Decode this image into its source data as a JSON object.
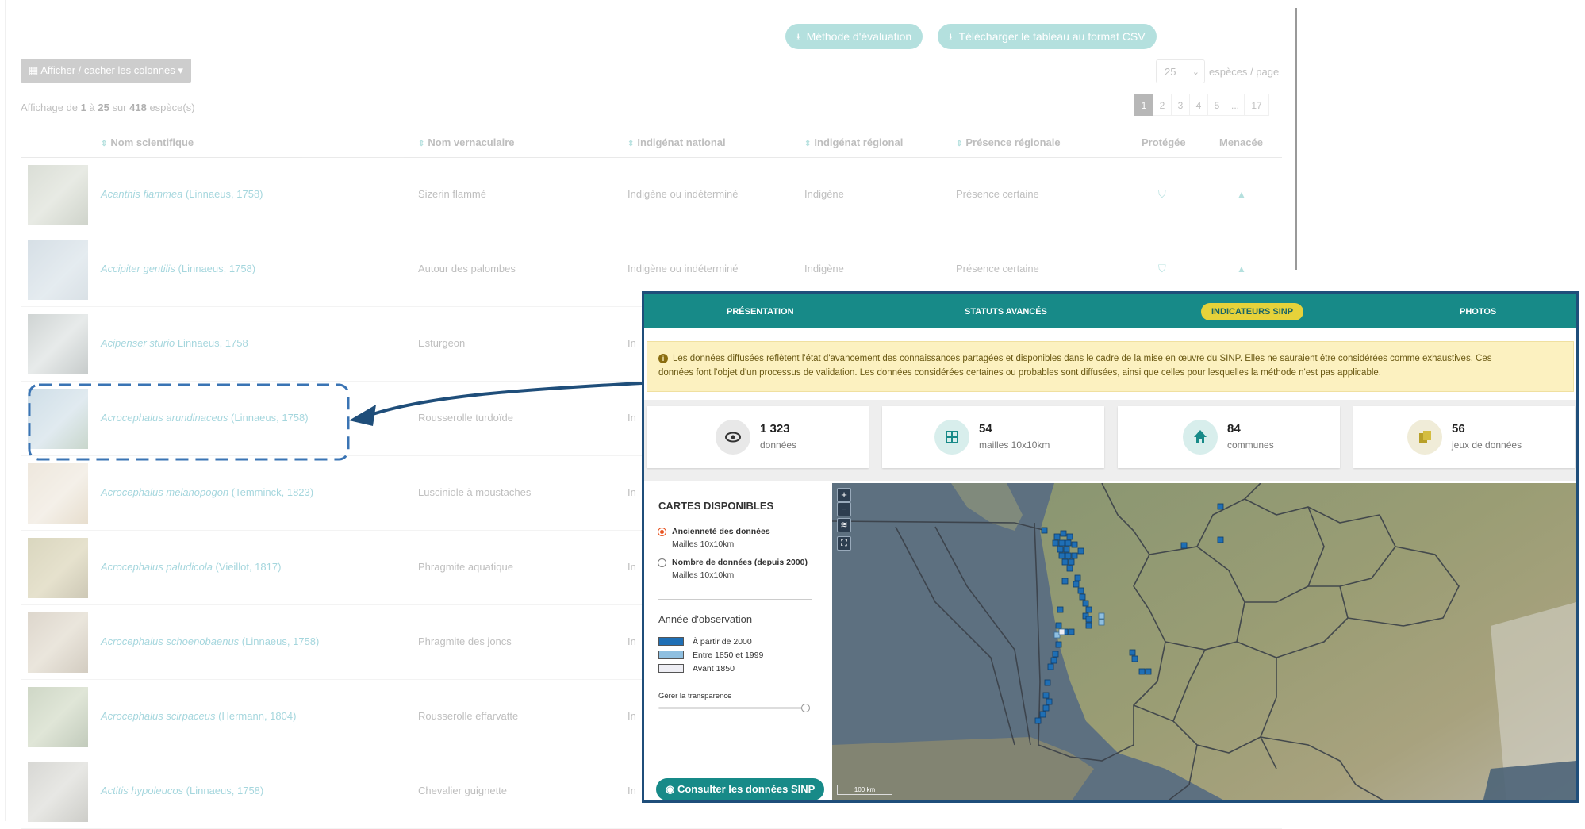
{
  "toolbar": {
    "method_label": "Méthode d'évaluation",
    "csv_label": "Télécharger le tableau au format CSV",
    "columns_label": "Afficher / cacher les colonnes ▾",
    "per_page_value": "25",
    "per_page_label": "espèces / page"
  },
  "summary": {
    "prefix": "Affichage de ",
    "from": "1",
    "mid": " à ",
    "to": "25",
    "sur": " sur ",
    "total": "418",
    "suffix": " espèce(s)"
  },
  "pagination": [
    "1",
    "2",
    "3",
    "4",
    "5",
    "...",
    "17"
  ],
  "table": {
    "headers": {
      "sci": "Nom scientifique",
      "vern": "Nom vernaculaire",
      "nat": "Indigénat national",
      "reg": "Indigénat régional",
      "pres": "Présence régionale",
      "prot": "Protégée",
      "men": "Menacée"
    },
    "rows": [
      {
        "sci": "Acanthis flammea",
        "auth": " (Linnaeus, 1758)",
        "vern": "Sizerin flammé",
        "nat": "Indigène ou indéterminé",
        "reg": "Indigène",
        "pres": "Présence certaine"
      },
      {
        "sci": "Accipiter gentilis",
        "auth": " (Linnaeus, 1758)",
        "vern": "Autour des palombes",
        "nat": "Indigène ou indéterminé",
        "reg": "Indigène",
        "pres": "Présence certaine"
      },
      {
        "sci": "Acipenser sturio",
        "auth": " Linnaeus, 1758",
        "vern": "Esturgeon",
        "nat": "In"
      },
      {
        "sci": "Acrocephalus arundinaceus",
        "auth": " (Linnaeus, 1758)",
        "vern": "Rousserolle turdoïde",
        "nat": "In"
      },
      {
        "sci": "Acrocephalus melanopogon",
        "auth": " (Temminck, 1823)",
        "vern": "Lusciniole à moustaches",
        "nat": "In"
      },
      {
        "sci": "Acrocephalus paludicola",
        "auth": " (Vieillot, 1817)",
        "vern": "Phragmite aquatique",
        "nat": "In"
      },
      {
        "sci": "Acrocephalus schoenobaenus",
        "auth": " (Linnaeus, 1758)",
        "vern": "Phragmite des joncs",
        "nat": "In"
      },
      {
        "sci": "Acrocephalus scirpaceus",
        "auth": " (Hermann, 1804)",
        "vern": "Rousserolle effarvatte",
        "nat": "In"
      },
      {
        "sci": "Actitis hypoleucos",
        "auth": " (Linnaeus, 1758)",
        "vern": "Chevalier guignette",
        "nat": "In"
      }
    ]
  },
  "popup": {
    "tabs": [
      "PRÉSENTATION",
      "STATUTS AVANCÉS",
      "INDICATEURS SINP",
      "PHOTOS"
    ],
    "notice_line1": "Les données diffusées reflètent l'état d'avancement des connaissances partagées et disponibles dans le cadre de la mise en œuvre du SINP. Elles ne sauraient être considérées comme exhaustives. Ces",
    "notice_line2": "données font l'objet d'un processus de validation. Les données considérées certaines ou probables sont diffusées, ainsi que celles pour lesquelles la méthode n'est pas applicable.",
    "stats": [
      {
        "value": "1 323",
        "label": "données",
        "icon": "eye-icon"
      },
      {
        "value": "54",
        "label": "mailles 10x10km",
        "icon": "grid-icon"
      },
      {
        "value": "84",
        "label": "communes",
        "icon": "town-icon"
      },
      {
        "value": "56",
        "label": "jeux de données",
        "icon": "dataset-icon"
      }
    ],
    "maps_title": "CARTES DISPONIBLES",
    "option1_label": "Ancienneté des données",
    "option1_sub": "Mailles 10x10km",
    "option2_label": "Nombre de données (depuis 2000)",
    "option2_sub": "Mailles 10x10km",
    "year_title": "Année d'observation",
    "legend": [
      {
        "label": "À partir de 2000",
        "color": "#1f6fb5"
      },
      {
        "label": "Entre 1850 et 1999",
        "color": "#8fbfe0"
      },
      {
        "label": "Avant 1850",
        "color": "#eeeef4"
      }
    ],
    "transparency_label": "Gérer la transparence",
    "transparency_value": 1,
    "sinp_button": "Consulter les données SINP",
    "scale_label": "100 km"
  },
  "colors": {
    "teal": "#178a88",
    "yellow": "#e6d23a",
    "accent": "#4fb6b3",
    "frame": "#1f4e7a"
  }
}
